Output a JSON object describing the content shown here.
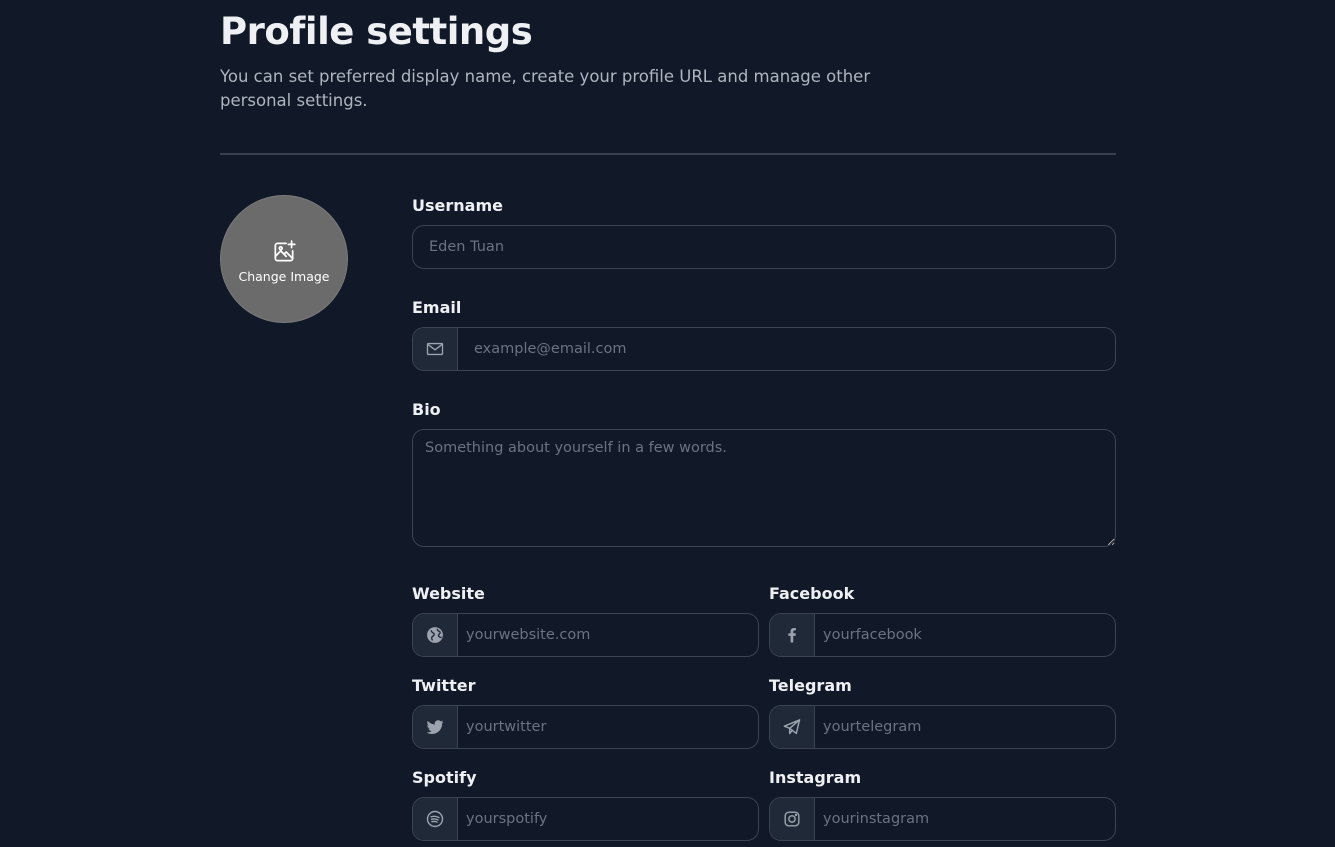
{
  "header": {
    "title": "Profile settings",
    "subtitle": "You can set preferred display name, create your profile URL and manage other personal settings."
  },
  "avatar": {
    "label": "Change Image",
    "icon": "image-plus-icon",
    "color": "#6b6b6b"
  },
  "form": {
    "username": {
      "label": "Username",
      "placeholder": "Eden Tuan"
    },
    "email": {
      "label": "Email",
      "placeholder": "example@email.com",
      "icon": "mail-icon"
    },
    "bio": {
      "label": "Bio",
      "placeholder": "Something about yourself in a few words."
    },
    "website": {
      "label": "Website",
      "placeholder": "yourwebsite.com",
      "icon": "globe-icon"
    },
    "facebook": {
      "label": "Facebook",
      "placeholder": "yourfacebook",
      "icon": "facebook-icon"
    },
    "twitter": {
      "label": "Twitter",
      "placeholder": "yourtwitter",
      "icon": "twitter-icon"
    },
    "telegram": {
      "label": "Telegram",
      "placeholder": "yourtelegram",
      "icon": "telegram-icon"
    },
    "spotify": {
      "label": "Spotify",
      "placeholder": "yourspotify",
      "icon": "spotify-icon"
    },
    "instagram": {
      "label": "Instagram",
      "placeholder": "yourinstagram",
      "icon": "instagram-icon"
    }
  },
  "colors": {
    "background": "#111827",
    "border": "#3b4452",
    "addon_background": "#1f2937",
    "icon": "#9ca3af",
    "placeholder": "#6b7280"
  }
}
